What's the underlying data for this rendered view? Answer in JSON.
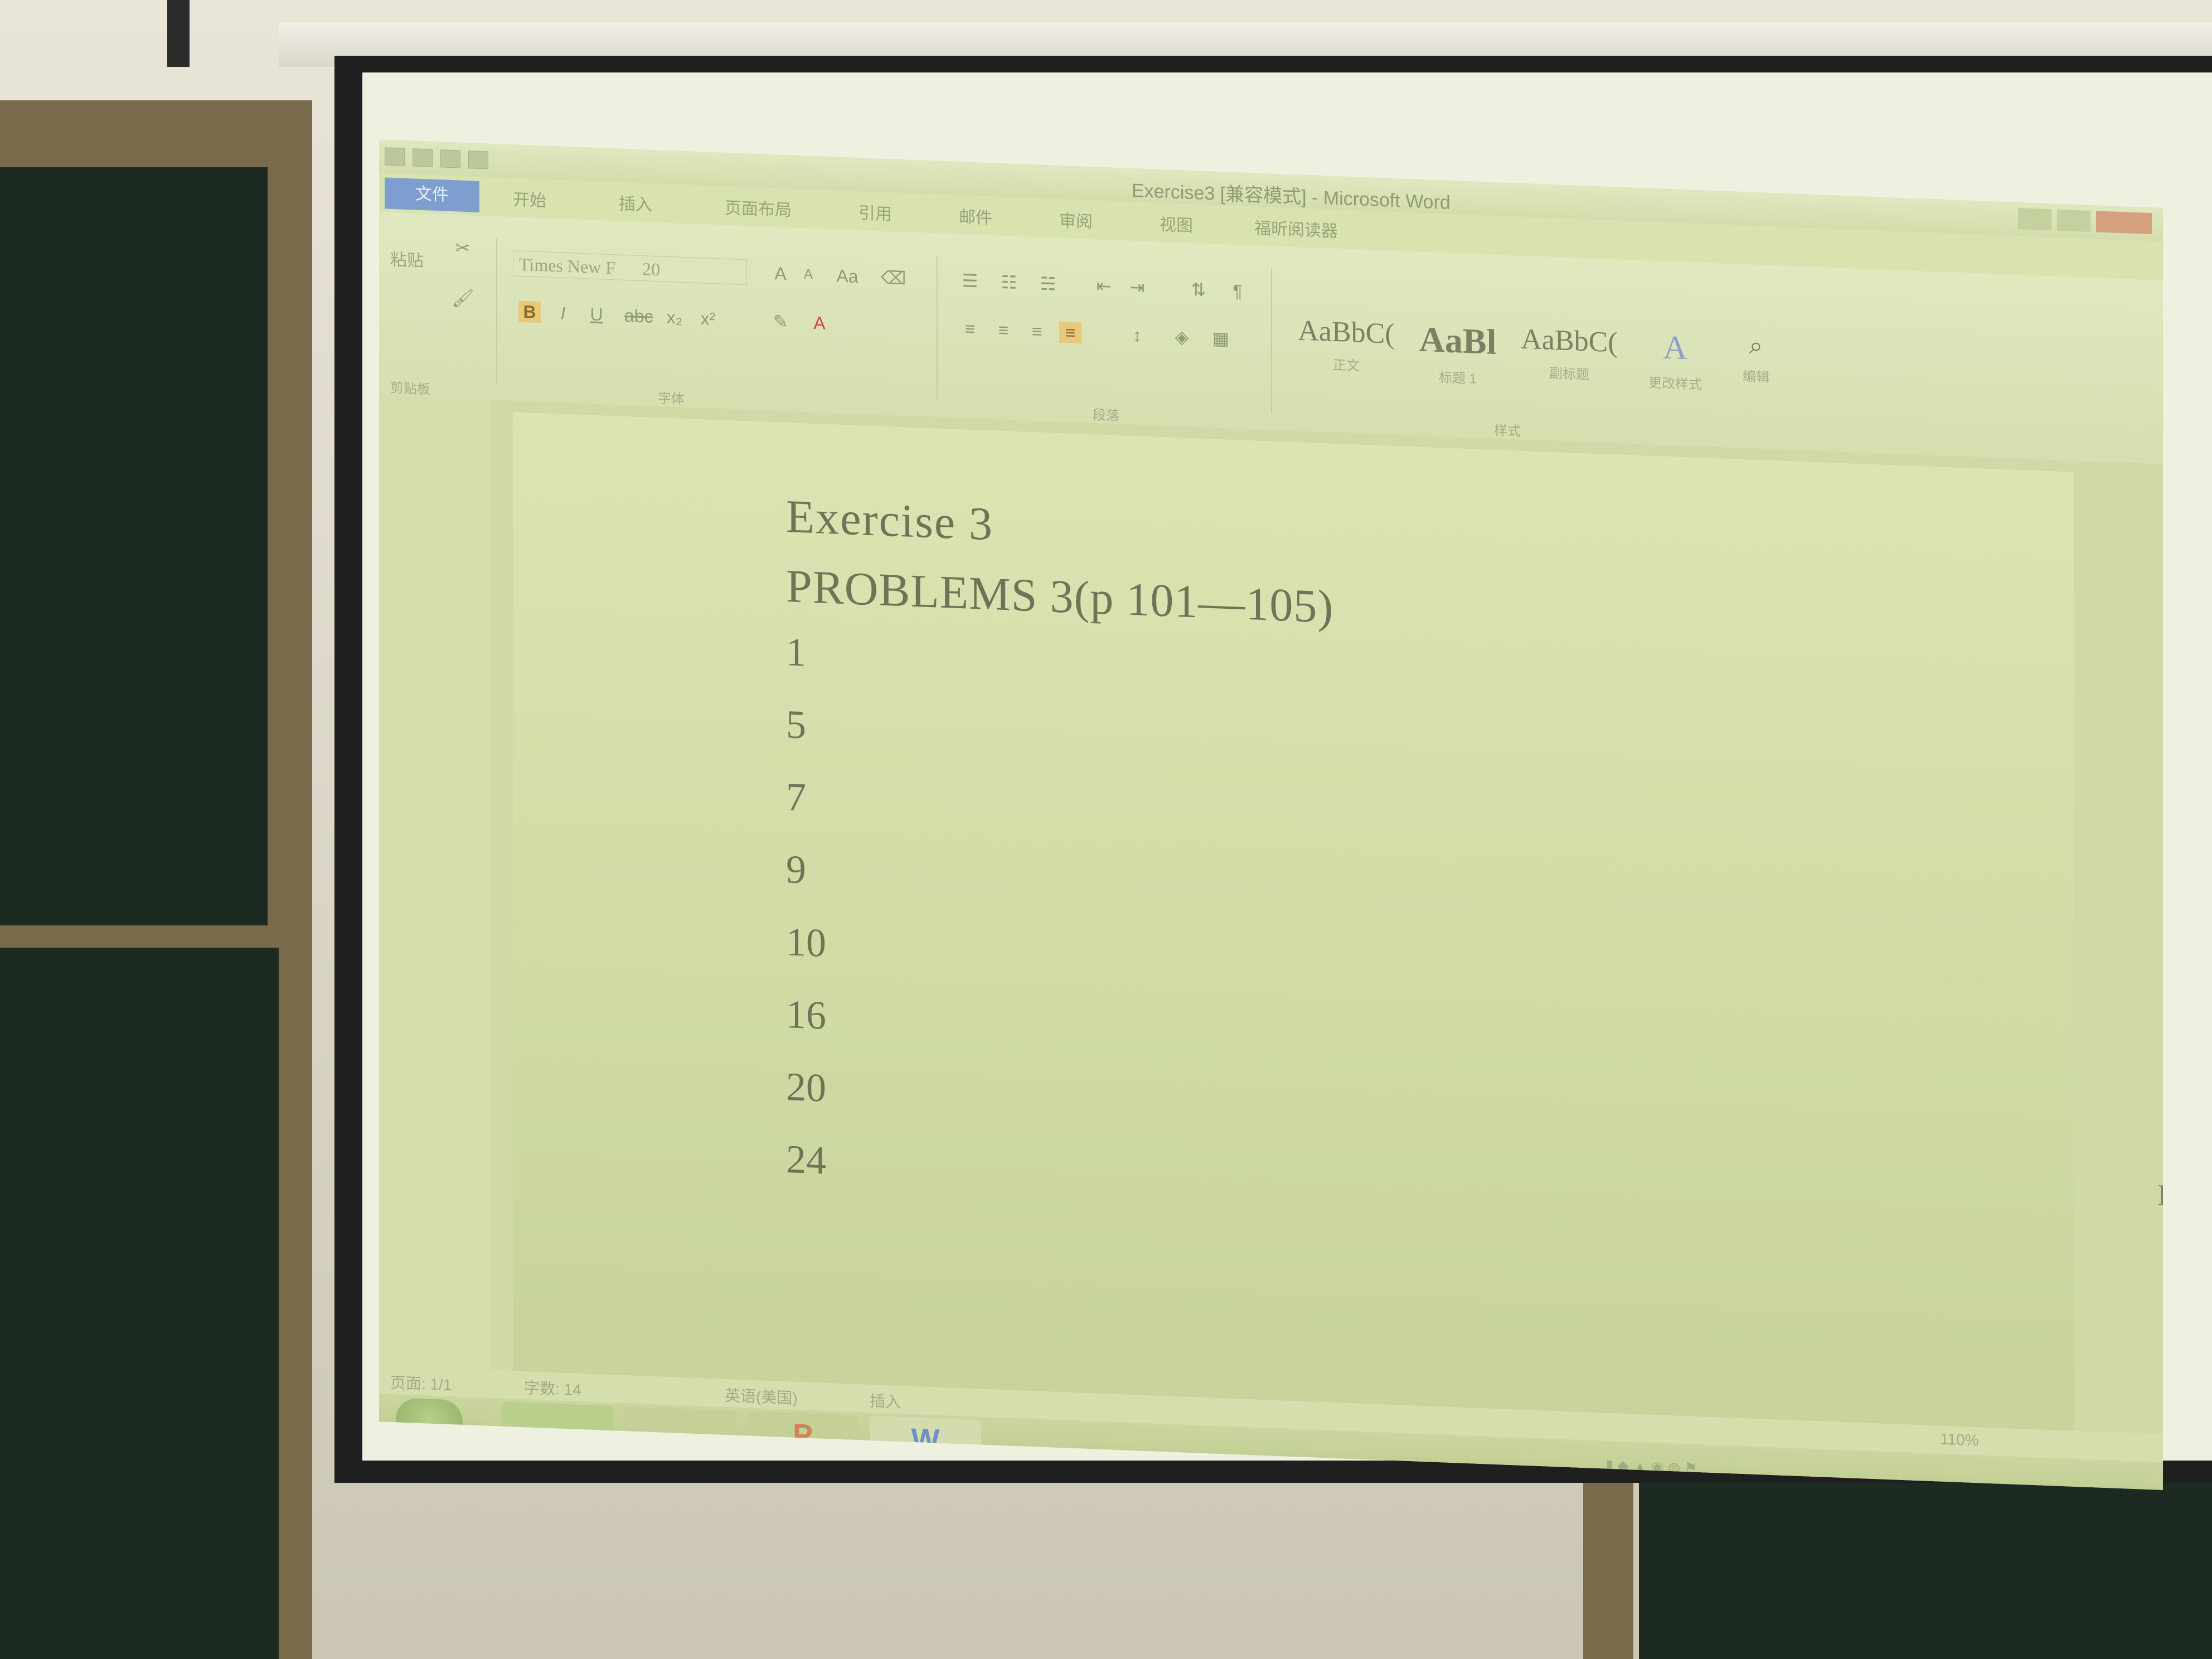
{
  "window": {
    "title": "Exercise3 [兼容模式] - Microsoft Word"
  },
  "ribbon_tabs": [
    "文件",
    "开始",
    "插入",
    "页面布局",
    "引用",
    "邮件",
    "审阅",
    "视图",
    "福昕阅读器"
  ],
  "home_ribbon": {
    "paste_label": "粘贴",
    "clipboard_label": "剪贴板",
    "font_name": "Times New F",
    "font_size": "20",
    "font_group_label": "字体",
    "paragraph_group_label": "段落",
    "styles_group_label": "样式",
    "styles": [
      {
        "sample": "AaBbC(",
        "caption": "正文"
      },
      {
        "sample": "AaBl",
        "caption": "标题 1"
      },
      {
        "sample": "AaBbC(",
        "caption": "副标题"
      }
    ],
    "change_styles_label": "更改样式",
    "edit_label": "编辑"
  },
  "document": {
    "title": "Exercise 3",
    "problems_heading": "PROBLEMS 3(p 101—105)",
    "items": [
      "1",
      "5",
      "7",
      "9",
      "10",
      "16",
      "20",
      "24"
    ]
  },
  "status_bar": {
    "page": "页面: 1/1",
    "words": "字数: 14",
    "language": "英语(美国)",
    "mode": "插入",
    "zoom": "110%"
  },
  "taskbar": {
    "apps": [
      {
        "label": "P",
        "icon": "powerpoint-icon"
      },
      {
        "label": "W",
        "icon": "word-icon"
      }
    ]
  },
  "colors": {
    "file_tab": "#7f9ed0",
    "bold_highlight": "#e8c97a",
    "projected_tint": "#d8e3b0",
    "chalkboard": "#1c2a22"
  }
}
